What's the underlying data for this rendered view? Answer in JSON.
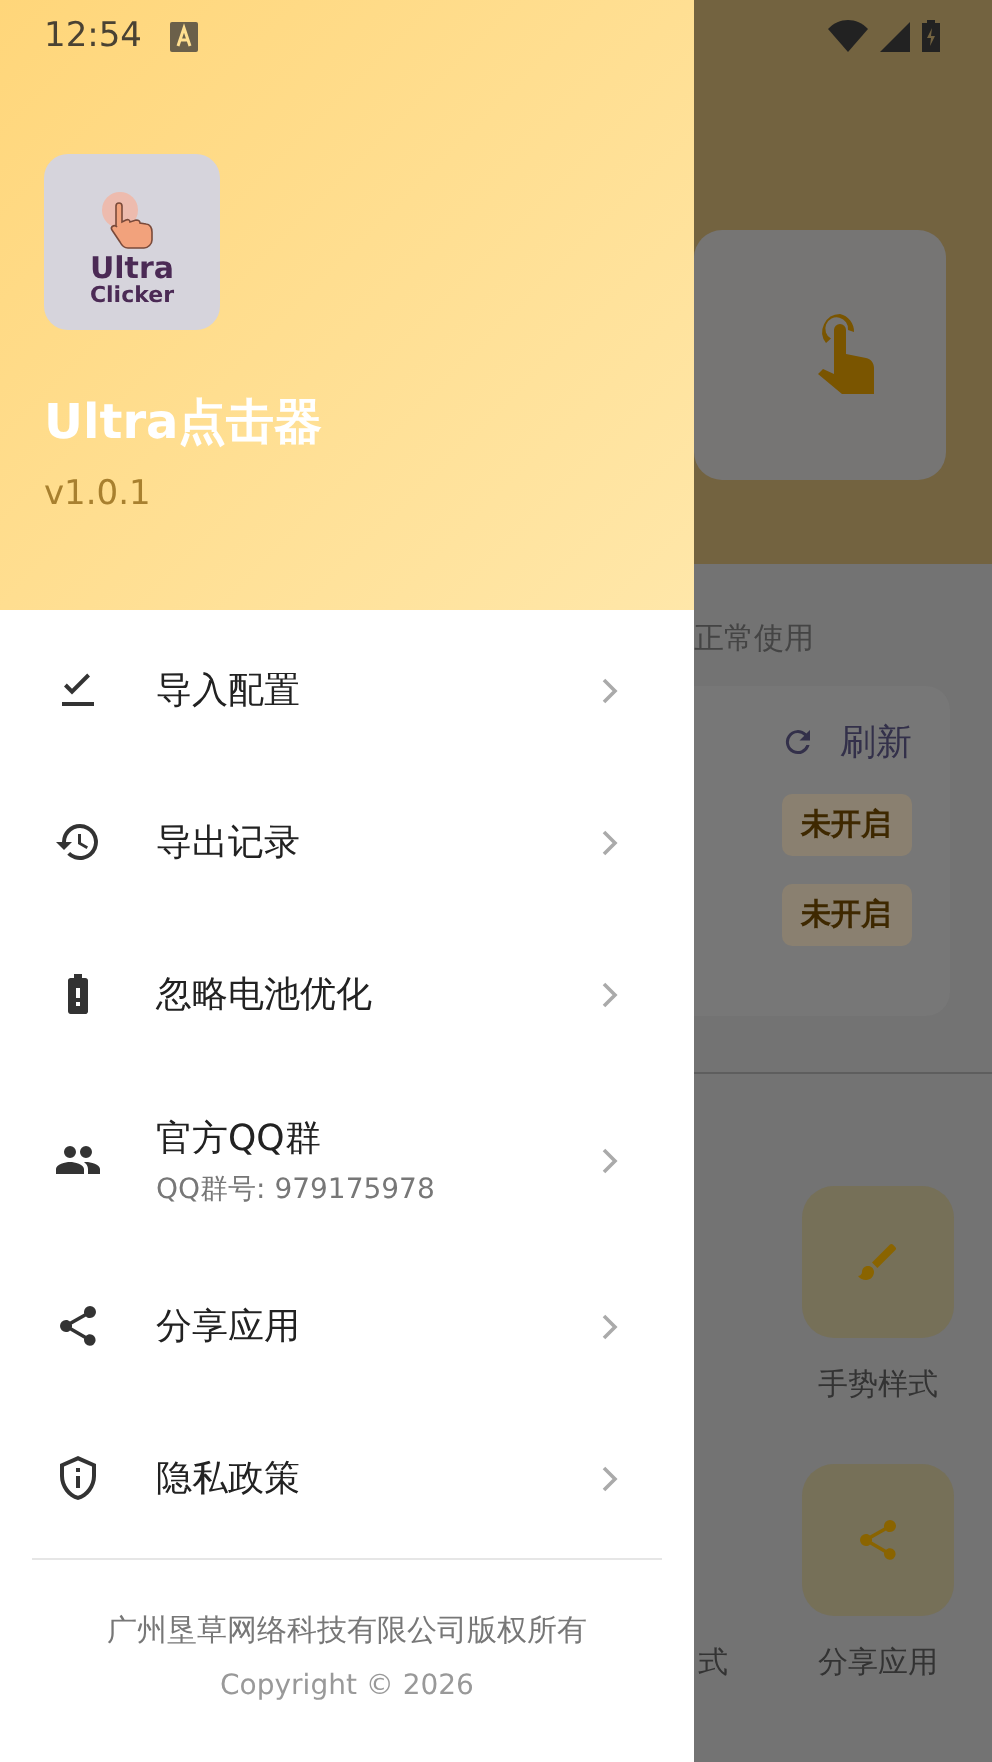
{
  "status_bar": {
    "time": "12:54"
  },
  "drawer": {
    "logo": {
      "line_1": "Ultra",
      "line_2": "Clicker"
    },
    "app_name": "Ultra点击器",
    "version": "v1.0.1",
    "menu": [
      {
        "kind": "import",
        "label": "导入配置"
      },
      {
        "kind": "history",
        "label": "导出记录"
      },
      {
        "kind": "battery",
        "label": "忽略电池优化"
      },
      {
        "kind": "group",
        "label": "官方QQ群",
        "subtitle": "QQ群号: 979175978"
      },
      {
        "kind": "share",
        "label": "分享应用"
      },
      {
        "kind": "shield",
        "label": "隐私政策"
      }
    ],
    "footer": {
      "company": "广州垦草网络科技有限公司版权所有",
      "copyright": "Copyright © 2026"
    }
  },
  "background": {
    "section_label": "正常使用",
    "refresh": "刷新",
    "badges": [
      "未开启",
      "未开启"
    ],
    "tiles": [
      {
        "kind": "brush",
        "label": "手势样式"
      },
      {
        "kind": "share",
        "label": "分享应用"
      }
    ],
    "cut_label": "式"
  }
}
